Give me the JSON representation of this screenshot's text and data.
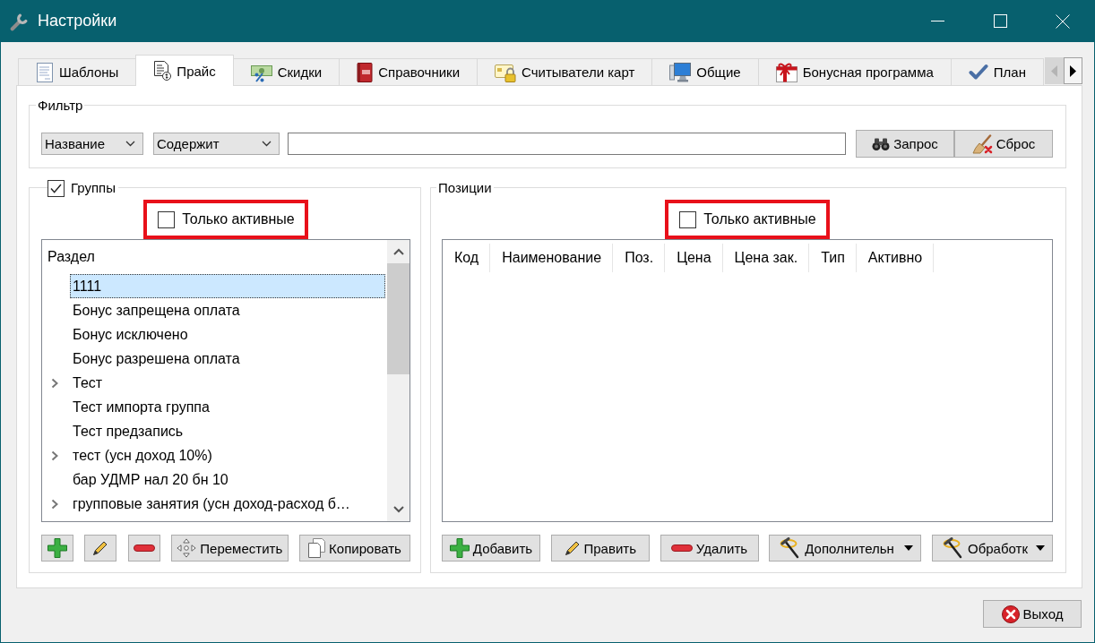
{
  "window": {
    "title": "Настройки"
  },
  "tabs": [
    {
      "label": "Шаблоны",
      "selected": false
    },
    {
      "label": "Прайс",
      "selected": true
    },
    {
      "label": "Скидки",
      "selected": false
    },
    {
      "label": "Справочники",
      "selected": false
    },
    {
      "label": "Считыватели карт",
      "selected": false
    },
    {
      "label": "Общие",
      "selected": false
    },
    {
      "label": "Бонусная программа",
      "selected": false
    },
    {
      "label": "План",
      "selected": false
    }
  ],
  "tab_scroll": {
    "back": {
      "disabled": true
    },
    "forward": {
      "disabled": false
    }
  },
  "filter": {
    "title": "Фильтр",
    "field": {
      "value": "Название"
    },
    "condition": {
      "value": "Содержит"
    },
    "buttons": [
      {
        "kind": "query",
        "label": "Запрос"
      },
      {
        "kind": "reset",
        "label": "Сброс"
      }
    ]
  },
  "groups": {
    "title": "Группы",
    "checked": true,
    "only_active": {
      "label": "Только активные",
      "checked": false,
      "highlighted": true
    },
    "tree": {
      "column": "Раздел",
      "items": [
        {
          "label": "1111",
          "kind": "leaf",
          "selected": true
        },
        {
          "label": "Бонус запрещена оплата",
          "kind": "leaf",
          "selected": false
        },
        {
          "label": "Бонус исключено",
          "kind": "leaf",
          "selected": false
        },
        {
          "label": "Бонус разрешена оплата",
          "kind": "leaf",
          "selected": false
        },
        {
          "label": "Тест",
          "kind": "branch",
          "expanded": false,
          "selected": false
        },
        {
          "label": "Тест импорта группа",
          "kind": "leaf",
          "selected": false
        },
        {
          "label": "Тест предзапись",
          "kind": "leaf",
          "selected": false
        },
        {
          "label": "тест (усн доход 10%)",
          "kind": "branch",
          "expanded": false,
          "selected": false
        },
        {
          "label": "бар УДМР нал 20 бн 10",
          "kind": "leaf",
          "selected": false
        },
        {
          "label": "групповые занятия (усн доход-расход б…",
          "kind": "branch",
          "expanded": false,
          "selected": false
        }
      ]
    },
    "buttons": [
      {
        "kind": "add"
      },
      {
        "kind": "edit"
      },
      {
        "kind": "delete"
      },
      {
        "kind": "move",
        "label": "Переместить"
      },
      {
        "kind": "copy",
        "label": "Копировать"
      }
    ]
  },
  "positions": {
    "title": "Позиции",
    "only_active": {
      "label": "Только активные",
      "checked": false,
      "highlighted": true
    },
    "table": {
      "columns": [
        "Код",
        "Наименование",
        "Поз.",
        "Цена",
        "Цена зак.",
        "Тип",
        "Активно"
      ]
    },
    "buttons": [
      {
        "kind": "add",
        "label": "Добавить",
        "menu": false
      },
      {
        "kind": "edit",
        "label": "Править",
        "menu": false
      },
      {
        "kind": "delete",
        "label": "Удалить",
        "menu": false
      },
      {
        "kind": "more",
        "label": "Дополнительн",
        "menu": true
      },
      {
        "kind": "processing",
        "label": "Обработк",
        "menu": true
      }
    ]
  },
  "footer": {
    "buttons": [
      {
        "kind": "exit",
        "label": "Выход"
      }
    ]
  }
}
